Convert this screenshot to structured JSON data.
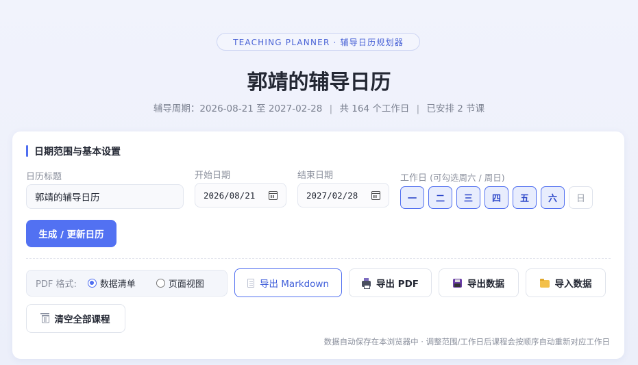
{
  "header": {
    "badge": "TEACHING PLANNER · 辅导日历规划器",
    "title": "郭靖的辅导日历",
    "period": "辅导周期：2026-08-21 至 2027-02-28",
    "workdays": "共 164 个工作日",
    "scheduled": "已安排 2 节课",
    "separator": "|"
  },
  "settings": {
    "section_title": "日期范围与基本设置",
    "calendar_title_label": "日历标题",
    "calendar_title_value": "郭靖的辅导日历",
    "start_label": "开始日期",
    "start_value": "2026/08/21",
    "end_label": "结束日期",
    "end_value": "2027/02/28",
    "workday_label": "工作日",
    "workday_hint": "(可勾选周六 / 周日)",
    "days": [
      {
        "label": "一",
        "selected": true
      },
      {
        "label": "二",
        "selected": true
      },
      {
        "label": "三",
        "selected": true
      },
      {
        "label": "四",
        "selected": true
      },
      {
        "label": "五",
        "selected": true
      },
      {
        "label": "六",
        "selected": true
      },
      {
        "label": "日",
        "selected": false
      }
    ],
    "generate_label": "生成 / 更新日历"
  },
  "export": {
    "pdf_format_label": "PDF 格式:",
    "option_list": "数据清单",
    "option_page": "页面视图",
    "selected_option": "数据清单",
    "markdown_label": "导出 Markdown",
    "pdf_label": "导出 PDF",
    "export_data_label": "导出数据",
    "import_data_label": "导入数据",
    "clear_label": "清空全部课程",
    "footnote": "数据自动保存在本浏览器中 · 调整范围/工作日后课程会按顺序自动重新对应工作日"
  },
  "colors": {
    "accent": "#4f6ef0",
    "primary_button": "#5271f2",
    "background": "#eef1fb"
  },
  "icons": {
    "date": "calendar-icon",
    "markdown": "document-icon",
    "pdf": "printer-icon",
    "export": "floppy-disk-icon",
    "import": "folder-icon",
    "clear": "trash-icon"
  }
}
